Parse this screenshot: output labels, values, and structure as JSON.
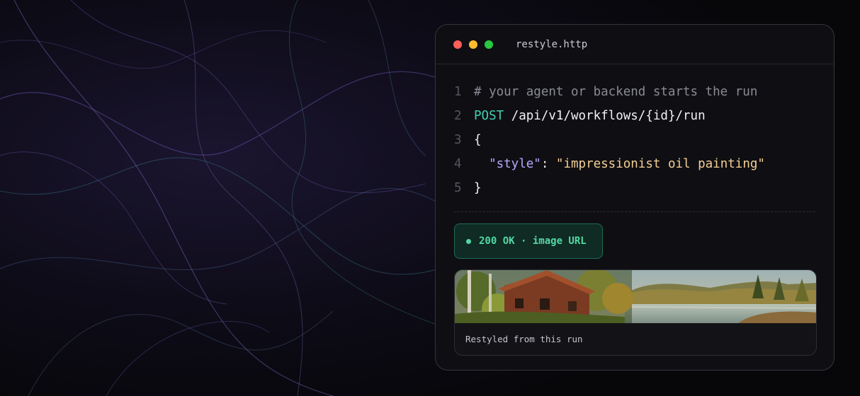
{
  "window": {
    "filename": "restyle.http",
    "traffic_lights": {
      "close_color": "#ff5f57",
      "minimize_color": "#febc2e",
      "maximize_color": "#28c840"
    }
  },
  "code": {
    "line_numbers": [
      "1",
      "2",
      "3",
      "4",
      "5"
    ],
    "comment": "# your agent or backend starts the run",
    "method": "POST",
    "path": " /api/v1/workflows/{id}/run",
    "open_brace": "{",
    "key": "\"style\"",
    "colon": ": ",
    "value": "\"impressionist oil painting\"",
    "close_brace": "}"
  },
  "response": {
    "status_text": "200 OK · image URL",
    "status_color": "#53d7a5"
  },
  "result": {
    "image_alt": "impressionist oil painting of a cabin by a lake",
    "caption": "Restyled from this run"
  }
}
